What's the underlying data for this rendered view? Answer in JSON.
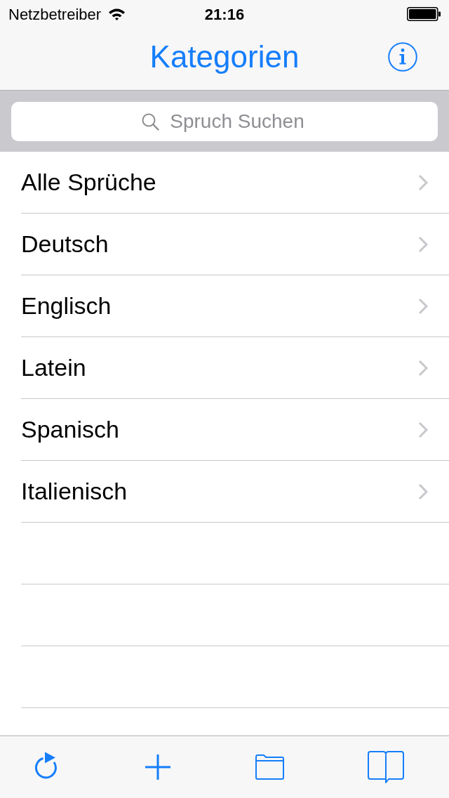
{
  "status_bar": {
    "carrier": "Netzbetreiber",
    "time": "21:16"
  },
  "nav_bar": {
    "title": "Kategorien"
  },
  "search": {
    "placeholder": "Spruch Suchen"
  },
  "categories": [
    {
      "label": "Alle Sprüche"
    },
    {
      "label": "Deutsch"
    },
    {
      "label": "Englisch"
    },
    {
      "label": "Latein"
    },
    {
      "label": "Spanisch"
    },
    {
      "label": "Italienisch"
    }
  ]
}
